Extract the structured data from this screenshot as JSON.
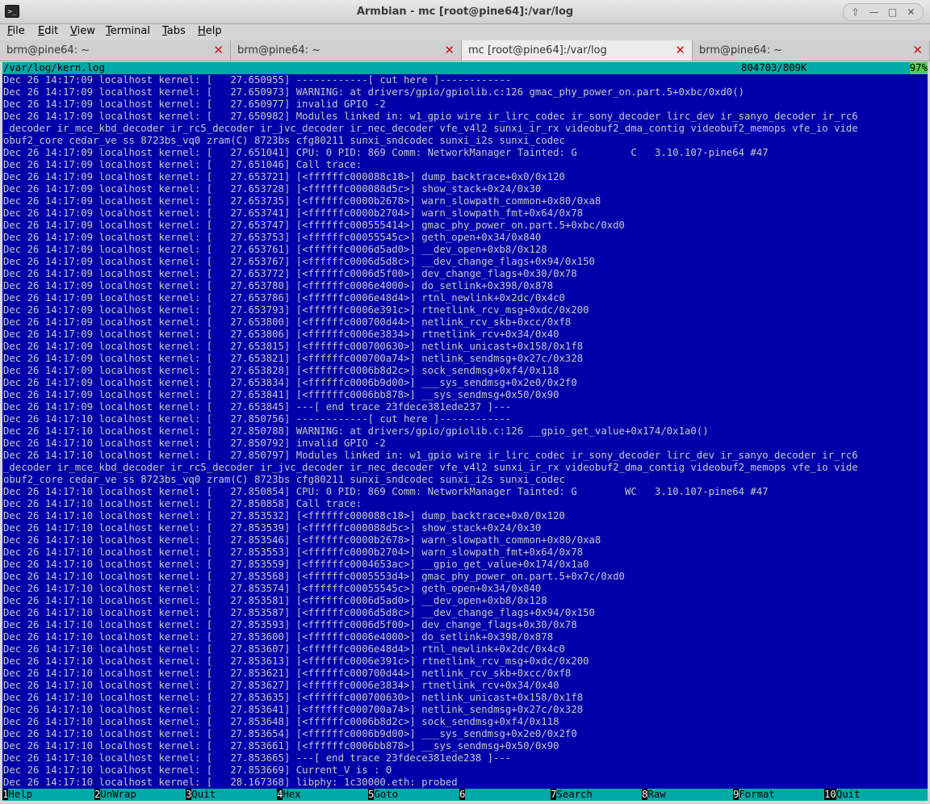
{
  "window": {
    "title": "Armbian - mc [root@pine64]:/var/log",
    "app_icon": "terminal-icon",
    "controls": [
      "scroll-up-icon",
      "minimize-icon",
      "maximize-icon",
      "close-icon"
    ]
  },
  "menubar": {
    "items": [
      {
        "label": "File",
        "mnemonic": "F",
        "rest": "ile"
      },
      {
        "label": "Edit",
        "mnemonic": "E",
        "rest": "dit"
      },
      {
        "label": "View",
        "mnemonic": "V",
        "rest": "iew"
      },
      {
        "label": "Terminal",
        "mnemonic": "T",
        "rest": "erminal"
      },
      {
        "label": "Tabs",
        "mnemonic": "T",
        "rest": "abs"
      },
      {
        "label": "Help",
        "mnemonic": "H",
        "rest": "elp"
      }
    ]
  },
  "tabs": [
    {
      "label": "brm@pine64: ~",
      "active": false
    },
    {
      "label": "brm@pine64: ~",
      "active": false
    },
    {
      "label": "mc [root@pine64]:/var/log",
      "active": true
    },
    {
      "label": "brm@pine64: ~",
      "active": false
    }
  ],
  "viewer": {
    "path": "/var/log/kern.log",
    "position": "804703/809K",
    "percent": "97%"
  },
  "log_lines": [
    "Dec 26 14:17:09 localhost kernel: [   27.650955] ------------[ cut here ]------------",
    "Dec 26 14:17:09 localhost kernel: [   27.650973] WARNING: at drivers/gpio/gpiolib.c:126 gmac_phy_power_on.part.5+0xbc/0xd0()",
    "Dec 26 14:17:09 localhost kernel: [   27.650977] invalid GPIO -2",
    "Dec 26 14:17:09 localhost kernel: [   27.650982] Modules linked in: w1_gpio wire ir_lirc_codec ir_sony_decoder lirc_dev ir_sanyo_decoder ir_rc6",
    "_decoder ir_mce_kbd_decoder ir_rc5_decoder ir_jvc_decoder ir_nec_decoder vfe_v4l2 sunxi_ir_rx videobuf2_dma_contig videobuf2_memops vfe_io vide",
    "obuf2_core cedar_ve ss 8723bs_vq0 zram(C) 8723bs cfg80211 sunxi_sndcodec sunxi_i2s sunxi_codec",
    "Dec 26 14:17:09 localhost kernel: [   27.651041] CPU: 0 PID: 869 Comm: NetworkManager Tainted: G         C   3.10.107-pine64 #47",
    "Dec 26 14:17:09 localhost kernel: [   27.651046] Call trace:",
    "Dec 26 14:17:09 localhost kernel: [   27.653721] [<ffffffc000088c18>] dump_backtrace+0x0/0x120",
    "Dec 26 14:17:09 localhost kernel: [   27.653728] [<ffffffc000088d5c>] show_stack+0x24/0x30",
    "Dec 26 14:17:09 localhost kernel: [   27.653735] [<ffffffc0000b2678>] warn_slowpath_common+0x80/0xa8",
    "Dec 26 14:17:09 localhost kernel: [   27.653741] [<ffffffc0000b2704>] warn_slowpath_fmt+0x64/0x78",
    "Dec 26 14:17:09 localhost kernel: [   27.653747] [<ffffffc000555414>] gmac_phy_power_on.part.5+0xbc/0xd0",
    "Dec 26 14:17:09 localhost kernel: [   27.653753] [<ffffffc00055545c>] geth_open+0x34/0x840",
    "Dec 26 14:17:09 localhost kernel: [   27.653761] [<ffffffc0006d5ad0>] __dev_open+0xb8/0x128",
    "Dec 26 14:17:09 localhost kernel: [   27.653767] [<ffffffc0006d5d8c>] __dev_change_flags+0x94/0x150",
    "Dec 26 14:17:09 localhost kernel: [   27.653772] [<ffffffc0006d5f00>] dev_change_flags+0x30/0x78",
    "Dec 26 14:17:09 localhost kernel: [   27.653780] [<ffffffc0006e4000>] do_setlink+0x398/0x878",
    "Dec 26 14:17:09 localhost kernel: [   27.653786] [<ffffffc0006e48d4>] rtnl_newlink+0x2dc/0x4c0",
    "Dec 26 14:17:09 localhost kernel: [   27.653793] [<ffffffc0006e391c>] rtnetlink_rcv_msg+0xdc/0x200",
    "Dec 26 14:17:09 localhost kernel: [   27.653800] [<ffffffc000700d44>] netlink_rcv_skb+0xcc/0xf8",
    "Dec 26 14:17:09 localhost kernel: [   27.653806] [<ffffffc0006e3834>] rtnetlink_rcv+0x34/0x40",
    "Dec 26 14:17:09 localhost kernel: [   27.653815] [<ffffffc000700630>] netlink_unicast+0x158/0x1f8",
    "Dec 26 14:17:09 localhost kernel: [   27.653821] [<ffffffc000700a74>] netlink_sendmsg+0x27c/0x328",
    "Dec 26 14:17:09 localhost kernel: [   27.653828] [<ffffffc0006b8d2c>] sock_sendmsg+0xf4/0x118",
    "Dec 26 14:17:09 localhost kernel: [   27.653834] [<ffffffc0006b9d00>] ___sys_sendmsg+0x2e0/0x2f0",
    "Dec 26 14:17:09 localhost kernel: [   27.653841] [<ffffffc0006bb878>] __sys_sendmsg+0x50/0x90",
    "Dec 26 14:17:09 localhost kernel: [   27.653845] ---[ end trace 23fdece381ede237 ]---",
    "Dec 26 14:17:10 localhost kernel: [   27.850756] ------------[ cut here ]------------",
    "Dec 26 14:17:10 localhost kernel: [   27.850788] WARNING: at drivers/gpio/gpiolib.c:126 __gpio_get_value+0x174/0x1a0()",
    "Dec 26 14:17:10 localhost kernel: [   27.850792] invalid GPIO -2",
    "Dec 26 14:17:10 localhost kernel: [   27.850797] Modules linked in: w1_gpio wire ir_lirc_codec ir_sony_decoder lirc_dev ir_sanyo_decoder ir_rc6",
    "_decoder ir_mce_kbd_decoder ir_rc5_decoder ir_jvc_decoder ir_nec_decoder vfe_v4l2 sunxi_ir_rx videobuf2_dma_contig videobuf2_memops vfe_io vide",
    "obuf2_core cedar_ve ss 8723bs_vq0 zram(C) 8723bs cfg80211 sunxi_sndcodec sunxi_i2s sunxi_codec",
    "Dec 26 14:17:10 localhost kernel: [   27.850854] CPU: 0 PID: 869 Comm: NetworkManager Tainted: G        WC   3.10.107-pine64 #47",
    "Dec 26 14:17:10 localhost kernel: [   27.850858] Call trace:",
    "Dec 26 14:17:10 localhost kernel: [   27.853532] [<ffffffc000088c18>] dump_backtrace+0x0/0x120",
    "Dec 26 14:17:10 localhost kernel: [   27.853539] [<ffffffc000088d5c>] show_stack+0x24/0x30",
    "Dec 26 14:17:10 localhost kernel: [   27.853546] [<ffffffc0000b2678>] warn_slowpath_common+0x80/0xa8",
    "Dec 26 14:17:10 localhost kernel: [   27.853553] [<ffffffc0000b2704>] warn_slowpath_fmt+0x64/0x78",
    "Dec 26 14:17:10 localhost kernel: [   27.853559] [<ffffffc0004653ac>] __gpio_get_value+0x174/0x1a0",
    "Dec 26 14:17:10 localhost kernel: [   27.853568] [<ffffffc0005553d4>] gmac_phy_power_on.part.5+0x7c/0xd0",
    "Dec 26 14:17:10 localhost kernel: [   27.853574] [<ffffffc00055545c>] geth_open+0x34/0x840",
    "Dec 26 14:17:10 localhost kernel: [   27.853581] [<ffffffc0006d5ad0>] __dev_open+0xb8/0x128",
    "Dec 26 14:17:10 localhost kernel: [   27.853587] [<ffffffc0006d5d8c>] __dev_change_flags+0x94/0x150",
    "Dec 26 14:17:10 localhost kernel: [   27.853593] [<ffffffc0006d5f00>] dev_change_flags+0x30/0x78",
    "Dec 26 14:17:10 localhost kernel: [   27.853600] [<ffffffc0006e4000>] do_setlink+0x398/0x878",
    "Dec 26 14:17:10 localhost kernel: [   27.853607] [<ffffffc0006e48d4>] rtnl_newlink+0x2dc/0x4c0",
    "Dec 26 14:17:10 localhost kernel: [   27.853613] [<ffffffc0006e391c>] rtnetlink_rcv_msg+0xdc/0x200",
    "Dec 26 14:17:10 localhost kernel: [   27.853621] [<ffffffc000700d44>] netlink_rcv_skb+0xcc/0xf8",
    "Dec 26 14:17:10 localhost kernel: [   27.853627] [<ffffffc0006e3834>] rtnetlink_rcv+0x34/0x40",
    "Dec 26 14:17:10 localhost kernel: [   27.853635] [<ffffffc000700630>] netlink_unicast+0x158/0x1f8",
    "Dec 26 14:17:10 localhost kernel: [   27.853641] [<ffffffc000700a74>] netlink_sendmsg+0x27c/0x328",
    "Dec 26 14:17:10 localhost kernel: [   27.853648] [<ffffffc0006b8d2c>] sock_sendmsg+0xf4/0x118",
    "Dec 26 14:17:10 localhost kernel: [   27.853654] [<ffffffc0006b9d00>] ___sys_sendmsg+0x2e0/0x2f0",
    "Dec 26 14:17:10 localhost kernel: [   27.853661] [<ffffffc0006bb878>] __sys_sendmsg+0x50/0x90",
    "Dec 26 14:17:10 localhost kernel: [   27.853665] ---[ end trace 23fdece381ede238 ]---",
    "Dec 26 14:17:10 localhost kernel: [   27.853669] Current_V is : 0",
    "Dec 26 14:17:10 localhost kernel: [   28.167368] libphy: 1c30000.eth: probed"
  ],
  "fkeys": [
    {
      "num": "1",
      "label": "Help"
    },
    {
      "num": "2",
      "label": "UnWrap"
    },
    {
      "num": "3",
      "label": "Quit"
    },
    {
      "num": "4",
      "label": "Hex"
    },
    {
      "num": "5",
      "label": "Goto"
    },
    {
      "num": "6",
      "label": ""
    },
    {
      "num": "7",
      "label": "Search"
    },
    {
      "num": "8",
      "label": "Raw"
    },
    {
      "num": "9",
      "label": "Format"
    },
    {
      "num": "10",
      "label": "Quit"
    }
  ],
  "colors": {
    "terminal_bg": "#0000aa",
    "terminal_fg": "#c8c8c8",
    "bar_bg": "#00a8a8",
    "tab_close": "#cc1111"
  }
}
